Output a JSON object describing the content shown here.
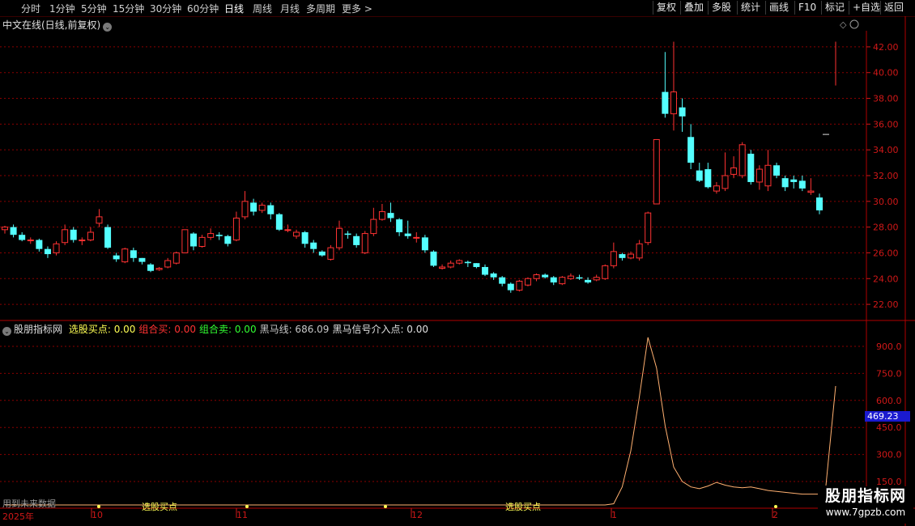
{
  "toolbar": {
    "timeframes": [
      "分时",
      "1分钟",
      "5分钟",
      "15分钟",
      "30分钟",
      "60分钟",
      "日线",
      "周线",
      "月线",
      "多周期",
      "更多 >"
    ],
    "active_timeframe": "日线",
    "right_buttons": [
      "复权",
      "叠加",
      "多股",
      "统计",
      "画线",
      "F10",
      "标记",
      "+自选",
      "返回"
    ]
  },
  "main_chart": {
    "title": "中文在线(日线,前复权)",
    "y_ticks": [
      "42.00",
      "40.00",
      "38.00",
      "36.00",
      "34.00",
      "32.00",
      "30.00",
      "28.00",
      "26.00",
      "24.00",
      "22.00"
    ],
    "candle_up_color": "#ff3232",
    "candle_down_color": "#54ffff"
  },
  "indicator": {
    "name": "股朋指标网",
    "values": [
      {
        "label": "选股买点: 0.00",
        "color": "#ffff54"
      },
      {
        "label": "组合买: 0.00",
        "color": "#ff3232"
      },
      {
        "label": "组合卖: 0.00",
        "color": "#32ff32"
      },
      {
        "label": "黑马线: 686.09",
        "color": "#c8c8c8"
      },
      {
        "label": "黑马信号介入点: 0.00",
        "color": "#e0e0e0"
      }
    ],
    "y_ticks": [
      "900.0",
      "750.0",
      "600.0",
      "450.0",
      "300.0",
      "150.0"
    ],
    "current_value": "469.23",
    "line_color": "#ffb070",
    "annotations": [
      "选股买点",
      "选股买点"
    ],
    "footer_text": "用到未来数据"
  },
  "time_axis": {
    "labels": [
      "2025年",
      "10",
      "11",
      "12",
      "1",
      "2"
    ]
  },
  "watermark": {
    "name": "股朋指标网",
    "url": "www.7gpzb.com"
  },
  "chart_data": {
    "type": "candlestick",
    "ylim": [
      21,
      43
    ],
    "candles": [
      [
        27.8,
        28.0,
        27.5,
        28.1
      ],
      [
        28.0,
        27.4,
        27.2,
        28.2
      ],
      [
        27.4,
        27.0,
        26.9,
        27.6
      ],
      [
        27.0,
        27.0,
        26.7,
        27.2
      ],
      [
        27.0,
        26.3,
        26.1,
        27.1
      ],
      [
        26.3,
        25.9,
        25.6,
        26.5
      ],
      [
        26.0,
        26.7,
        25.8,
        26.9
      ],
      [
        26.8,
        27.8,
        26.6,
        28.2
      ],
      [
        27.8,
        27.0,
        26.8,
        28.0
      ],
      [
        27.0,
        27.0,
        26.6,
        27.2
      ],
      [
        27.0,
        27.6,
        26.9,
        28.0
      ],
      [
        28.3,
        28.8,
        28.0,
        29.4
      ],
      [
        28.0,
        26.4,
        26.3,
        28.2
      ],
      [
        25.8,
        25.5,
        25.3,
        26.0
      ],
      [
        25.3,
        26.3,
        25.2,
        26.4
      ],
      [
        26.2,
        25.6,
        25.3,
        26.4
      ],
      [
        25.6,
        25.3,
        25.1,
        25.6
      ],
      [
        25.1,
        24.6,
        24.5,
        25.2
      ],
      [
        24.7,
        24.8,
        24.6,
        24.9
      ],
      [
        24.9,
        25.4,
        24.8,
        25.6
      ],
      [
        25.2,
        26.0,
        25.1,
        26.1
      ],
      [
        26.0,
        27.8,
        26.0,
        27.8
      ],
      [
        27.5,
        26.5,
        26.2,
        27.6
      ],
      [
        26.5,
        27.2,
        26.4,
        27.4
      ],
      [
        27.2,
        27.5,
        27.0,
        27.9
      ],
      [
        27.4,
        27.3,
        27.0,
        27.6
      ],
      [
        27.3,
        26.7,
        26.5,
        27.4
      ],
      [
        27.0,
        28.7,
        26.9,
        29.2
      ],
      [
        28.8,
        30.0,
        28.6,
        30.8
      ],
      [
        29.9,
        29.2,
        28.9,
        30.2
      ],
      [
        29.3,
        29.7,
        29.1,
        29.9
      ],
      [
        29.7,
        29.0,
        28.6,
        29.9
      ],
      [
        29.0,
        27.8,
        27.7,
        29.1
      ],
      [
        27.8,
        27.8,
        27.6,
        28.2
      ],
      [
        27.3,
        27.6,
        27.1,
        27.8
      ],
      [
        27.6,
        26.7,
        26.4,
        27.7
      ],
      [
        26.8,
        26.3,
        26.0,
        27.0
      ],
      [
        26.1,
        25.8,
        25.7,
        26.2
      ],
      [
        25.5,
        26.4,
        25.4,
        26.6
      ],
      [
        26.4,
        27.9,
        26.2,
        28.5
      ],
      [
        27.5,
        27.4,
        27.1,
        27.7
      ],
      [
        27.3,
        26.6,
        26.4,
        27.5
      ],
      [
        26.0,
        27.5,
        25.9,
        27.7
      ],
      [
        27.5,
        28.6,
        27.3,
        29.5
      ],
      [
        28.6,
        29.2,
        28.5,
        29.8
      ],
      [
        29.1,
        28.7,
        28.4,
        29.9
      ],
      [
        28.6,
        27.6,
        27.3,
        28.7
      ],
      [
        27.5,
        27.3,
        27.1,
        28.5
      ],
      [
        27.2,
        27.2,
        26.8,
        27.6
      ],
      [
        27.2,
        26.2,
        26.0,
        27.4
      ],
      [
        26.1,
        25.0,
        24.9,
        26.2
      ],
      [
        24.8,
        24.9,
        24.7,
        25.1
      ],
      [
        24.9,
        25.2,
        24.8,
        25.4
      ],
      [
        25.2,
        25.4,
        25.1,
        25.5
      ],
      [
        25.3,
        25.2,
        24.9,
        25.4
      ],
      [
        25.2,
        24.9,
        24.8,
        25.2
      ],
      [
        24.9,
        24.3,
        24.2,
        25.1
      ],
      [
        24.4,
        24.1,
        23.9,
        24.5
      ],
      [
        24.1,
        23.6,
        23.4,
        24.2
      ],
      [
        23.6,
        23.1,
        22.9,
        23.7
      ],
      [
        23.1,
        23.8,
        23.0,
        23.9
      ],
      [
        23.5,
        24.0,
        23.4,
        24.1
      ],
      [
        24.0,
        24.3,
        23.8,
        24.4
      ],
      [
        24.3,
        24.1,
        24.0,
        24.4
      ],
      [
        24.1,
        23.7,
        23.5,
        24.2
      ],
      [
        23.6,
        24.1,
        23.5,
        24.2
      ],
      [
        24.0,
        24.2,
        23.9,
        24.4
      ],
      [
        24.1,
        24.0,
        23.9,
        24.3
      ],
      [
        23.9,
        23.7,
        23.6,
        24.1
      ],
      [
        23.9,
        24.1,
        23.8,
        24.3
      ],
      [
        24.0,
        25.0,
        23.9,
        25.1
      ],
      [
        25.0,
        26.1,
        24.8,
        26.8
      ],
      [
        25.9,
        25.6,
        25.4,
        26.0
      ],
      [
        25.6,
        25.9,
        25.5,
        26.1
      ],
      [
        25.6,
        26.7,
        25.4,
        27.0
      ],
      [
        26.8,
        29.1,
        26.6,
        29.2
      ],
      [
        29.8,
        34.8,
        29.8,
        34.8
      ],
      [
        38.5,
        36.8,
        36.5,
        41.6
      ],
      [
        36.8,
        38.5,
        35.5,
        42.4
      ],
      [
        37.3,
        36.6,
        35.4,
        38.0
      ],
      [
        35.0,
        33.0,
        32.5,
        36.0
      ],
      [
        32.4,
        31.6,
        31.5,
        33.0
      ],
      [
        32.5,
        31.1,
        31.0,
        33.0
      ],
      [
        30.8,
        31.2,
        30.6,
        31.5
      ],
      [
        31.0,
        32.0,
        30.8,
        33.8
      ],
      [
        32.1,
        32.6,
        31.8,
        33.5
      ],
      [
        32.0,
        34.4,
        31.8,
        34.6
      ],
      [
        33.7,
        31.5,
        31.3,
        34.0
      ],
      [
        31.5,
        32.5,
        30.9,
        32.8
      ],
      [
        31.2,
        32.8,
        30.8,
        34.0
      ],
      [
        32.8,
        32.0,
        31.8,
        33.0
      ],
      [
        31.8,
        31.1,
        30.8,
        32.0
      ],
      [
        31.7,
        31.5,
        31.0,
        32.0
      ],
      [
        31.6,
        31.0,
        30.8,
        32.0
      ],
      [
        30.7,
        30.8,
        30.5,
        31.8
      ],
      [
        30.3,
        29.3,
        29.0,
        30.6
      ]
    ],
    "partial_last": [
      39.0,
      42.4
    ],
    "indicator_series": [
      40,
      40,
      40,
      40,
      40,
      40,
      40,
      40,
      40,
      40,
      40,
      40,
      40,
      40,
      40,
      40,
      40,
      40,
      40,
      40,
      40,
      40,
      40,
      40,
      40,
      40,
      40,
      40,
      40,
      40,
      40,
      40,
      40,
      40,
      40,
      40,
      40,
      40,
      40,
      40,
      40,
      40,
      40,
      40,
      40,
      40,
      40,
      40,
      40,
      40,
      40,
      40,
      40,
      40,
      40,
      40,
      40,
      40,
      40,
      40,
      40,
      40,
      40,
      40,
      40,
      40,
      40,
      40,
      40,
      40,
      40,
      45,
      120,
      320,
      620,
      950,
      780,
      460,
      230,
      150,
      120,
      110,
      125,
      145,
      130,
      120,
      115,
      120,
      110,
      100,
      95,
      90,
      85,
      80,
      80,
      80,
      "x",
      680
    ]
  }
}
